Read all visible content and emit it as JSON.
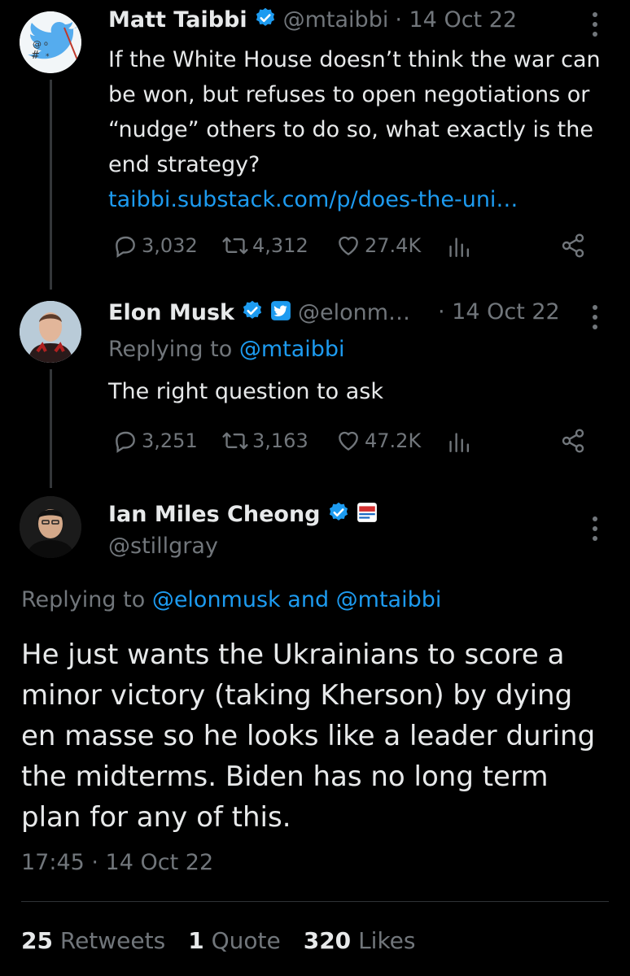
{
  "tweet1": {
    "name": "Matt Taibbi",
    "handle": "@mtaibbi",
    "date": "· 14 Oct 22",
    "text": "If the White House doesn’t think the war can be won, but refuses to open negotiations or “nudge” others to do so, what exactly is the end strategy?",
    "link": "taibbi.substack.com/p/does-the-uni…",
    "replies": "3,032",
    "retweets": "4,312",
    "likes": "27.4K"
  },
  "tweet2": {
    "name": "Elon Musk",
    "handle": "@elonm…",
    "date": "· 14 Oct 22",
    "replying_prefix": "Replying to",
    "replying_to": "@mtaibbi",
    "text": "The right question to ask",
    "replies": "3,251",
    "retweets": "3,163",
    "likes": "47.2K"
  },
  "tweet3": {
    "name": "Ian Miles Cheong",
    "handle": "@stillgray",
    "replying_prefix": "Replying to",
    "replying_to_1": "@elonmusk",
    "replying_and": "and",
    "replying_to_2": "@mtaibbi",
    "text": "He just wants the Ukrainians to score a minor victory (taking Kherson) by dying en masse so he looks like a leader during the midterms. Biden has no long term plan for any of this.",
    "timestamp": "17:45 · 14 Oct 22",
    "stats": {
      "retweets_count": "25",
      "retweets_label": "Retweets",
      "quotes_count": "1",
      "quotes_label": "Quote",
      "likes_count": "320",
      "likes_label": "Likes"
    }
  },
  "colors": {
    "background": "#000000",
    "text": "#e7e9ea",
    "secondary": "#71767b",
    "link": "#1d9bf0",
    "verified": "#1d9bf0"
  },
  "icons": [
    "reply-icon",
    "retweet-icon",
    "like-icon",
    "analytics-icon",
    "share-icon",
    "more-icon",
    "verified-badge-icon",
    "twitter-affiliate-badge-icon",
    "news-affiliate-badge-icon"
  ]
}
